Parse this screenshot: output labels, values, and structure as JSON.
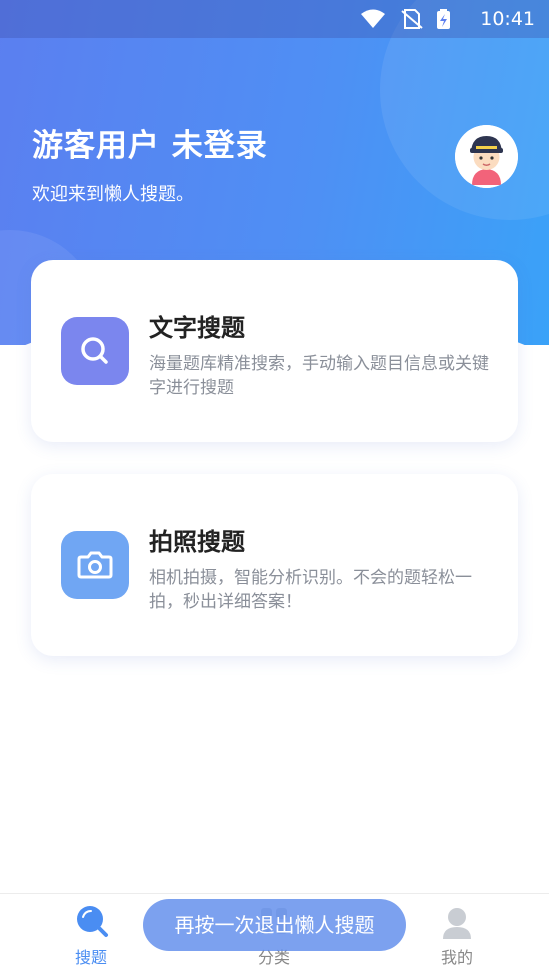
{
  "status_bar": {
    "time": "10:41",
    "icons": [
      "wifi-icon",
      "no-sim-icon",
      "battery-charging-icon"
    ]
  },
  "header": {
    "title": "游客用户 未登录",
    "subtitle": "欢迎来到懒人搜题。",
    "avatar": "avatar-icon"
  },
  "cards": [
    {
      "title": "文字搜题",
      "description": "海量题库精准搜索，手动输入题目信息或关键字进行搜题",
      "icon": "search-icon",
      "icon_color": "#7b86ee"
    },
    {
      "title": "拍照搜题",
      "description": "相机拍摄，智能分析识别。不会的题轻松一拍，秒出详细答案！",
      "icon": "camera-icon",
      "icon_color": "#70a6f3"
    }
  ],
  "tabbar": {
    "items": [
      {
        "label": "搜题",
        "icon": "search-tab-icon",
        "active": true
      },
      {
        "label": "分类",
        "icon": "category-tab-icon",
        "active": false
      },
      {
        "label": "我的",
        "icon": "profile-tab-icon",
        "active": false
      }
    ]
  },
  "toast": {
    "text": "再按一次退出懒人搜题"
  },
  "colors": {
    "accent": "#4f8ff4",
    "active_tab": "#4a8df2",
    "inactive_tab": "#888888"
  }
}
